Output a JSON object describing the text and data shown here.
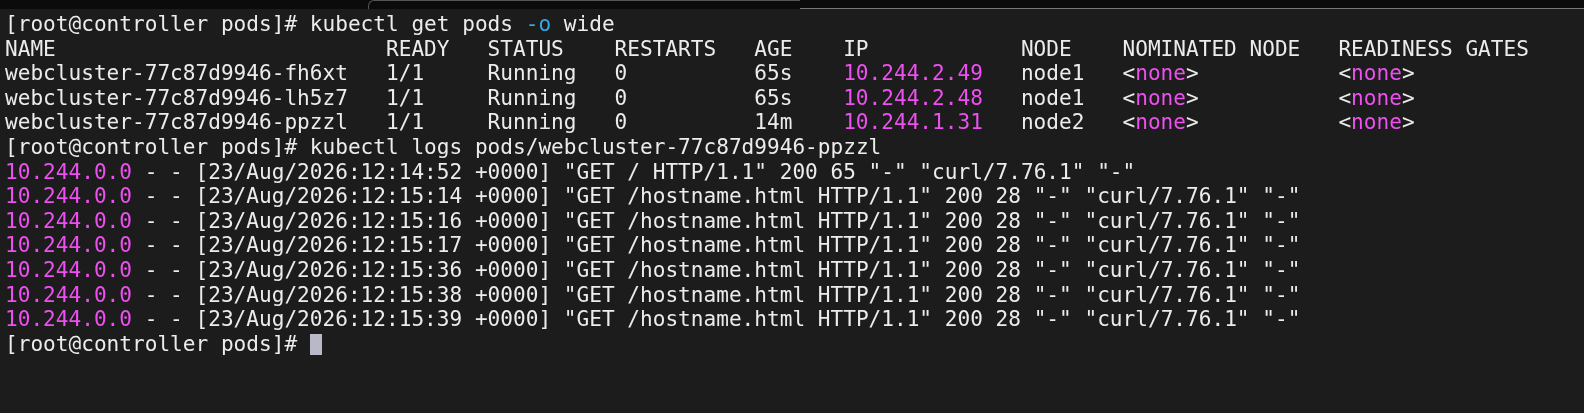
{
  "terminal": {
    "lines": [
      {
        "kind": "command",
        "prompt": "[root@controller pods]#",
        "segments": [
          {
            "text": "kubectl get pods",
            "kind": "plain"
          },
          {
            "text": "-o",
            "kind": "option"
          },
          {
            "text": "wide",
            "kind": "plain"
          }
        ]
      },
      {
        "kind": "table",
        "columns": [
          "NAME",
          "READY",
          "STATUS",
          "RESTARTS",
          "AGE",
          "IP",
          "NODE",
          "NOMINATED NODE",
          "READINESS GATES"
        ],
        "rows": [
          {
            "cells": [
              [
                {
                  "text": "webcluster-77c87d9946-fh6xt",
                  "kind": "plain"
                }
              ],
              [
                {
                  "text": "1/1",
                  "kind": "plain"
                }
              ],
              [
                {
                  "text": "Running",
                  "kind": "plain"
                }
              ],
              [
                {
                  "text": "0",
                  "kind": "plain"
                }
              ],
              [
                {
                  "text": "65s",
                  "kind": "plain"
                }
              ],
              [
                {
                  "text": "10.244.2.49",
                  "kind": "highlight"
                }
              ],
              [
                {
                  "text": "node1",
                  "kind": "plain"
                }
              ],
              [
                {
                  "text": "<",
                  "kind": "plain"
                },
                {
                  "text": "none",
                  "kind": "highlight"
                },
                {
                  "text": ">",
                  "kind": "plain"
                }
              ],
              [
                {
                  "text": "<",
                  "kind": "plain"
                },
                {
                  "text": "none",
                  "kind": "highlight"
                },
                {
                  "text": ">",
                  "kind": "plain"
                }
              ]
            ]
          },
          {
            "cells": [
              [
                {
                  "text": "webcluster-77c87d9946-lh5z7",
                  "kind": "plain"
                }
              ],
              [
                {
                  "text": "1/1",
                  "kind": "plain"
                }
              ],
              [
                {
                  "text": "Running",
                  "kind": "plain"
                }
              ],
              [
                {
                  "text": "0",
                  "kind": "plain"
                }
              ],
              [
                {
                  "text": "65s",
                  "kind": "plain"
                }
              ],
              [
                {
                  "text": "10.244.2.48",
                  "kind": "highlight"
                }
              ],
              [
                {
                  "text": "node1",
                  "kind": "plain"
                }
              ],
              [
                {
                  "text": "<",
                  "kind": "plain"
                },
                {
                  "text": "none",
                  "kind": "highlight"
                },
                {
                  "text": ">",
                  "kind": "plain"
                }
              ],
              [
                {
                  "text": "<",
                  "kind": "plain"
                },
                {
                  "text": "none",
                  "kind": "highlight"
                },
                {
                  "text": ">",
                  "kind": "plain"
                }
              ]
            ]
          },
          {
            "cells": [
              [
                {
                  "text": "webcluster-77c87d9946-ppzzl",
                  "kind": "plain"
                }
              ],
              [
                {
                  "text": "1/1",
                  "kind": "plain"
                }
              ],
              [
                {
                  "text": "Running",
                  "kind": "plain"
                }
              ],
              [
                {
                  "text": "0",
                  "kind": "plain"
                }
              ],
              [
                {
                  "text": "14m",
                  "kind": "plain"
                }
              ],
              [
                {
                  "text": "10.244.1.31",
                  "kind": "highlight"
                }
              ],
              [
                {
                  "text": "node2",
                  "kind": "plain"
                }
              ],
              [
                {
                  "text": "<",
                  "kind": "plain"
                },
                {
                  "text": "none",
                  "kind": "highlight"
                },
                {
                  "text": ">",
                  "kind": "plain"
                }
              ],
              [
                {
                  "text": "<",
                  "kind": "plain"
                },
                {
                  "text": "none",
                  "kind": "highlight"
                },
                {
                  "text": ">",
                  "kind": "plain"
                }
              ]
            ]
          }
        ]
      },
      {
        "kind": "command",
        "prompt": "[root@controller pods]#",
        "segments": [
          {
            "text": "kubectl logs pods/webcluster-77c87d9946-ppzzl",
            "kind": "plain"
          }
        ]
      },
      {
        "kind": "log",
        "client_ip": "10.244.0.0",
        "message": "- - [23/Aug/2026:12:14:52 +0000] \"GET / HTTP/1.1\" 200 65 \"-\" \"curl/7.76.1\" \"-\""
      },
      {
        "kind": "log",
        "client_ip": "10.244.0.0",
        "message": "- - [23/Aug/2026:12:15:14 +0000] \"GET /hostname.html HTTP/1.1\" 200 28 \"-\" \"curl/7.76.1\" \"-\""
      },
      {
        "kind": "log",
        "client_ip": "10.244.0.0",
        "message": "- - [23/Aug/2026:12:15:16 +0000] \"GET /hostname.html HTTP/1.1\" 200 28 \"-\" \"curl/7.76.1\" \"-\""
      },
      {
        "kind": "log",
        "client_ip": "10.244.0.0",
        "message": "- - [23/Aug/2026:12:15:17 +0000] \"GET /hostname.html HTTP/1.1\" 200 28 \"-\" \"curl/7.76.1\" \"-\""
      },
      {
        "kind": "log",
        "client_ip": "10.244.0.0",
        "message": "- - [23/Aug/2026:12:15:36 +0000] \"GET /hostname.html HTTP/1.1\" 200 28 \"-\" \"curl/7.76.1\" \"-\""
      },
      {
        "kind": "log",
        "client_ip": "10.244.0.0",
        "message": "- - [23/Aug/2026:12:15:38 +0000] \"GET /hostname.html HTTP/1.1\" 200 28 \"-\" \"curl/7.76.1\" \"-\""
      },
      {
        "kind": "log",
        "client_ip": "10.244.0.0",
        "message": "- - [23/Aug/2026:12:15:39 +0000] \"GET /hostname.html HTTP/1.1\" 200 28 \"-\" \"curl/7.76.1\" \"-\""
      },
      {
        "kind": "prompt",
        "prompt": "[root@controller pods]#"
      }
    ]
  }
}
